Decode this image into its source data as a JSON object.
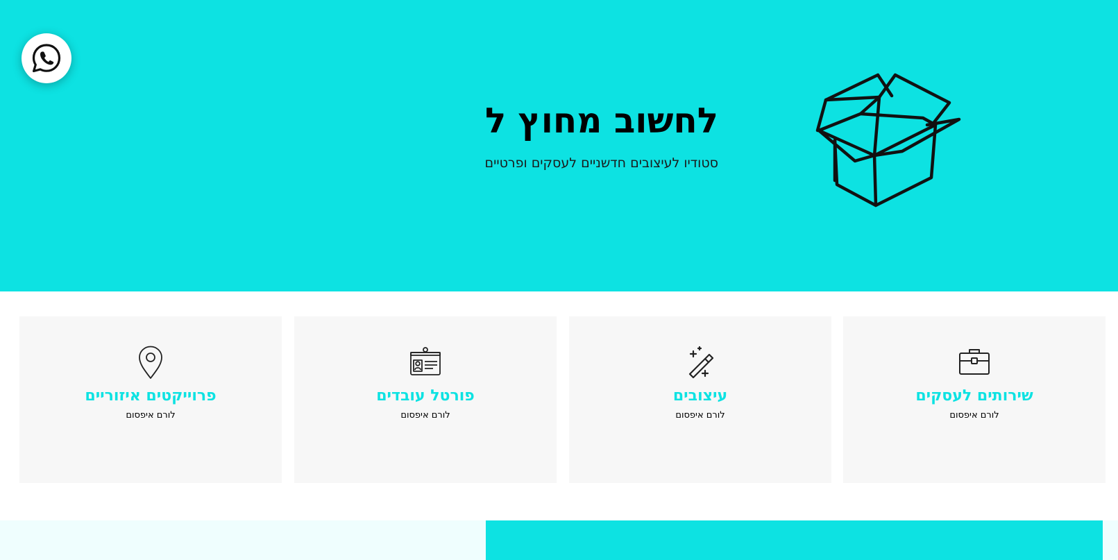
{
  "colors": {
    "accent": "#0de2e2",
    "card_bg": "#f7f7f7",
    "light_strip": "#effefe"
  },
  "floating": {
    "icon": "whatsapp-icon"
  },
  "hero": {
    "title": "לחשוב מחוץ ל",
    "subtitle": "סטודיו לעיצובים חדשניים לעסקים ופרטיים",
    "illustration": "open-box-icon"
  },
  "cards": [
    {
      "icon": "briefcase-icon",
      "title": "שירותים לעסקים",
      "text": "לורם איפסום"
    },
    {
      "icon": "magic-wand-icon",
      "title": "עיצובים",
      "text": "לורם איפסום"
    },
    {
      "icon": "id-card-icon",
      "title": "פורטל עובדים",
      "text": "לורם איפסום"
    },
    {
      "icon": "location-pin-icon",
      "title": "פרוייקטים איזוריים",
      "text": "לורם איפסום"
    }
  ]
}
